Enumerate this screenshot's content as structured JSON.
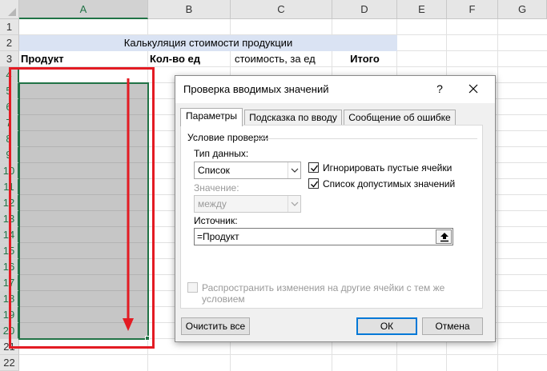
{
  "sheet": {
    "columns": [
      "A",
      "B",
      "C",
      "D",
      "E",
      "F",
      "G"
    ],
    "rows": [
      "1",
      "2",
      "3",
      "4",
      "5",
      "6",
      "7",
      "8",
      "9",
      "10",
      "11",
      "12",
      "13",
      "14",
      "15",
      "16",
      "17",
      "18",
      "19",
      "20",
      "21",
      "22"
    ],
    "title_cell": "Калькуляция стоимости продукции",
    "headers": {
      "product": "Продукт",
      "qty": "Кол-во ед",
      "unit_cost": "стоимость, за ед",
      "total": "Итого"
    }
  },
  "annotation": {
    "frame_color": "#e31b23"
  },
  "dialog": {
    "title": "Проверка вводимых значений",
    "help_glyph": "?",
    "tabs": [
      "Параметры",
      "Подсказка по вводу",
      "Сообщение об ошибке"
    ],
    "group_label": "Условие проверки",
    "data_type": {
      "label": "Тип данных:",
      "value": "Список"
    },
    "value": {
      "label": "Значение:",
      "value": "между"
    },
    "ignore_blank": {
      "label": "Игнорировать пустые ячейки",
      "checked": true
    },
    "in_cell_dropdown": {
      "label": "Список допустимых значений",
      "checked": true
    },
    "source": {
      "label": "Источник:",
      "value": "=Продукт"
    },
    "apply_all": {
      "label": "Распространить изменения на другие ячейки с тем же условием",
      "checked": false
    },
    "buttons": {
      "clear_all": "Очистить все",
      "ok": "ОК",
      "cancel": "Отмена"
    }
  }
}
